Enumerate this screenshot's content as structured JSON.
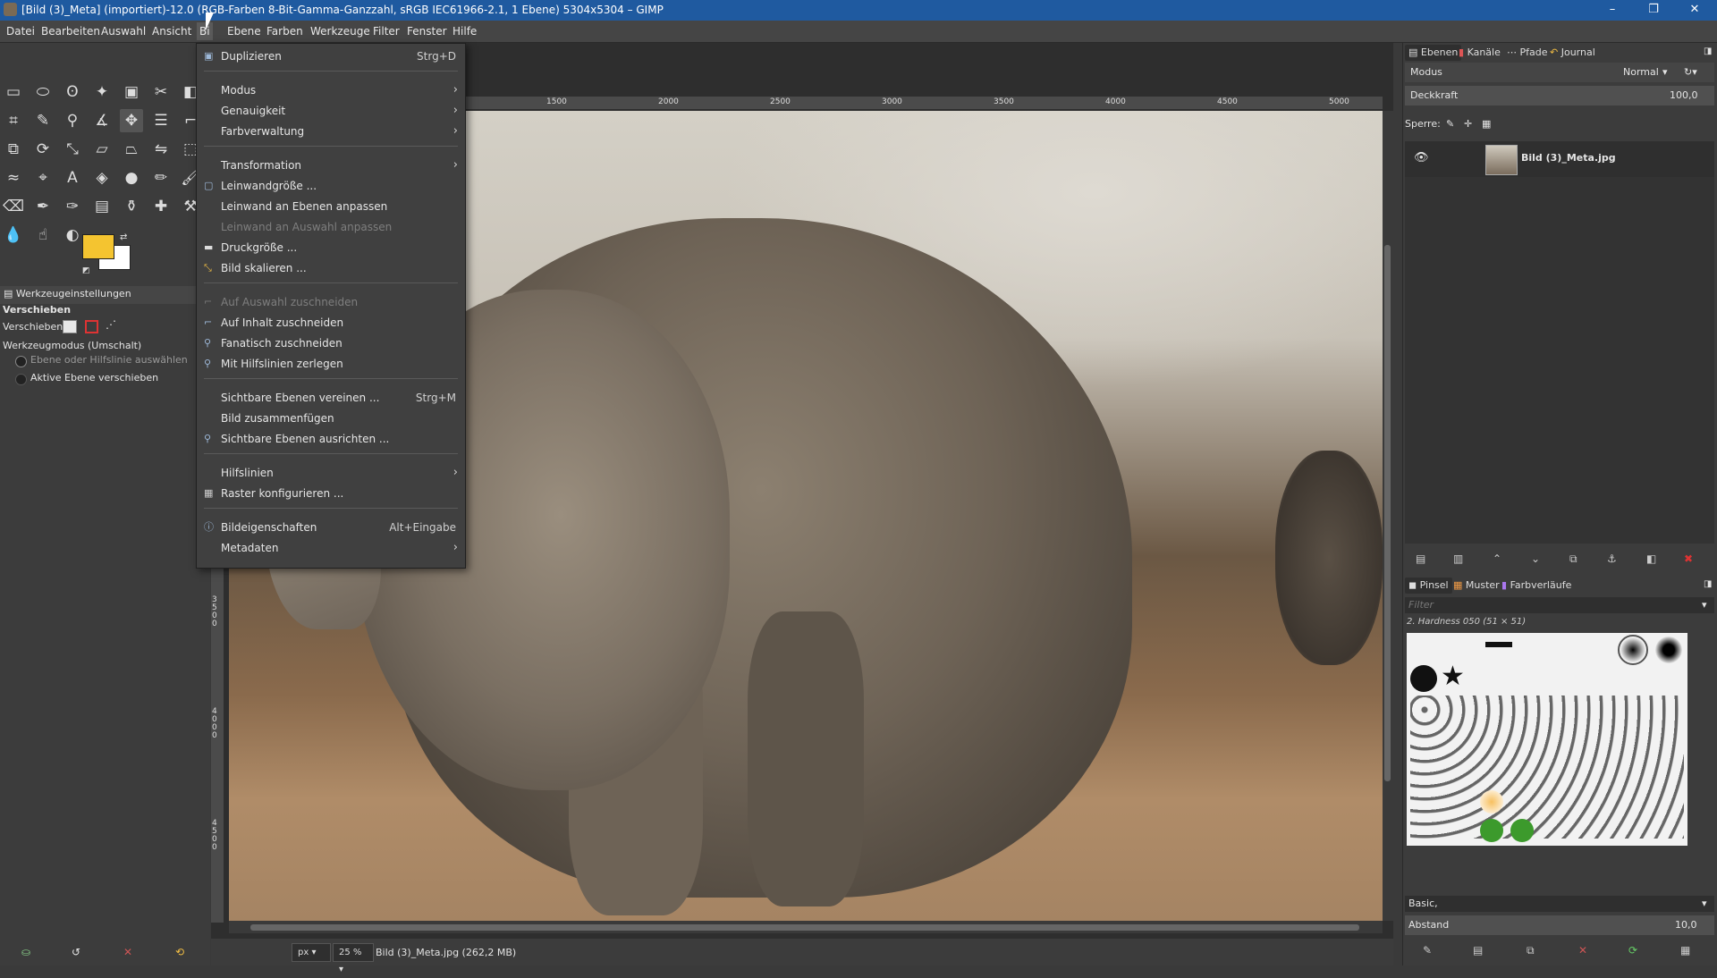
{
  "window": {
    "title": "[Bild (3)_Meta] (importiert)-12.0 (RGB-Farben 8-Bit-Gamma-Ganzzahl, sRGB IEC61966-2.1, 1 Ebene) 5304x5304 – GIMP",
    "minimize": "–",
    "maximize": "❐",
    "close": "✕"
  },
  "menubar": {
    "items": [
      "Datei",
      "Bearbeiten",
      "Auswahl",
      "Ansicht",
      "Bild",
      "Ebene",
      "Farben",
      "Werkzeuge",
      "Filter",
      "Fenster",
      "Hilfe"
    ],
    "active_partial": "Bi"
  },
  "bild_menu": {
    "items": [
      {
        "label": "Duplizieren",
        "shortcut": "Strg+D"
      },
      {
        "label": "Modus"
      },
      {
        "label": "Genauigkeit"
      },
      {
        "label": "Farbverwaltung"
      },
      {
        "label": "Transformation"
      },
      {
        "label": "Leinwandgröße ..."
      },
      {
        "label": "Leinwand an Ebenen anpassen"
      },
      {
        "label": "Leinwand an Auswahl anpassen"
      },
      {
        "label": "Druckgröße ..."
      },
      {
        "label": "Bild skalieren ..."
      },
      {
        "label": "Auf Auswahl zuschneiden"
      },
      {
        "label": "Auf Inhalt zuschneiden"
      },
      {
        "label": "Fanatisch zuschneiden"
      },
      {
        "label": "Mit Hilfslinien zerlegen"
      },
      {
        "label": "Sichtbare Ebenen vereinen ...",
        "shortcut": "Strg+M"
      },
      {
        "label": "Bild zusammenfügen"
      },
      {
        "label": "Sichtbare Ebenen ausrichten ..."
      },
      {
        "label": "Hilfslinien"
      },
      {
        "label": "Raster konfigurieren ..."
      },
      {
        "label": "Bildeigenschaften",
        "shortcut": "Alt+Eingabe"
      },
      {
        "label": "Metadaten"
      }
    ],
    "submenu_arrow": "›"
  },
  "tool_options": {
    "tab": "Werkzeugeinstellungen",
    "title": "Verschieben",
    "move_label": "Verschieben:",
    "mode_label": "Werkzeugmodus (Umschalt)",
    "radio1": "Ebene oder Hilfslinie auswählen",
    "radio2": "Aktive Ebene verschieben"
  },
  "ruler_h_ticks": [
    "1500",
    "2000",
    "2500",
    "3000",
    "3500",
    "4000",
    "4500",
    "5000"
  ],
  "ruler_v_ticks": [
    "3500",
    "4000",
    "4500"
  ],
  "status": {
    "unit": "px",
    "zoom": "25 %",
    "file": "Bild (3)_Meta.jpg (262,2 MB)"
  },
  "dock": {
    "tabs_top": [
      "Ebenen",
      "Kanäle",
      "Pfade",
      "Journal"
    ],
    "mode_label": "Modus",
    "mode_value": "Normal",
    "opacity_label": "Deckkraft",
    "opacity_value": "100,0",
    "lock_label": "Sperre:",
    "layer_name": "Bild (3)_Meta.jpg",
    "tabs_bottom": [
      "Pinsel",
      "Muster",
      "Farbverläufe"
    ],
    "filter_placeholder": "Filter",
    "brush_name": "2. Hardness 050 (51 × 51)",
    "brush_set": "Basic,",
    "spacing_label": "Abstand",
    "spacing_value": "10,0"
  },
  "colors": {
    "foreground": "#f4c430",
    "background": "#ffffff"
  }
}
